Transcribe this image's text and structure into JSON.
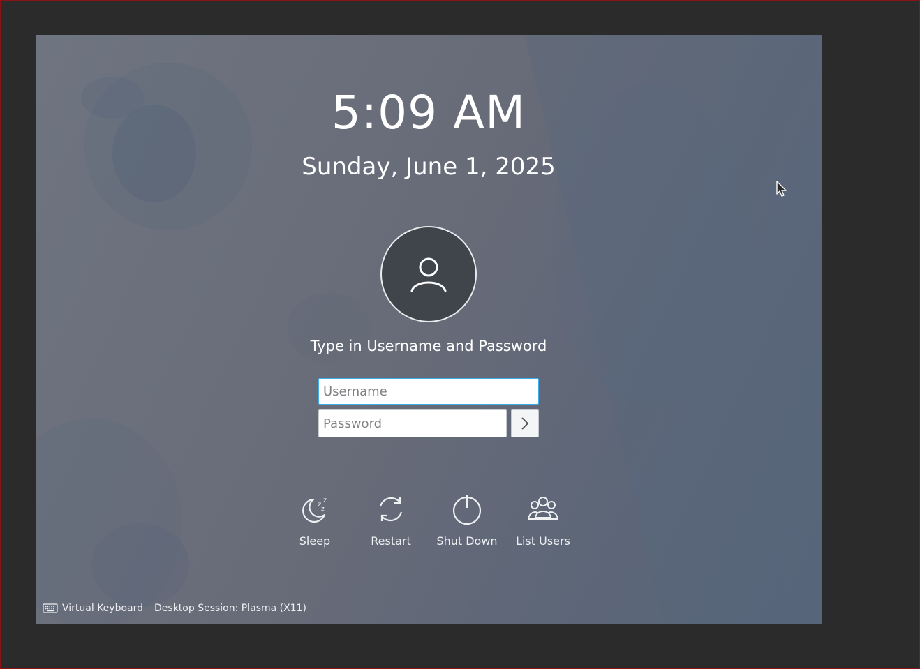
{
  "clock": {
    "time": "5:09 AM",
    "date": "Sunday, June 1, 2025"
  },
  "login": {
    "prompt": "Type in Username and Password",
    "username_placeholder": "Username",
    "username_value": "",
    "password_placeholder": "Password",
    "password_value": "",
    "submit_icon": "chevron-right-icon"
  },
  "actions": [
    {
      "label": "Sleep",
      "icon": "sleep-icon"
    },
    {
      "label": "Restart",
      "icon": "restart-icon"
    },
    {
      "label": "Shut Down",
      "icon": "power-icon"
    },
    {
      "label": "List Users",
      "icon": "users-icon"
    }
  ],
  "bottom_bar": {
    "virtual_keyboard": "Virtual Keyboard",
    "session": "Desktop Session: Plasma (X11)"
  },
  "colors": {
    "focus_accent": "#3daee9",
    "avatar_background": "#40444b"
  }
}
